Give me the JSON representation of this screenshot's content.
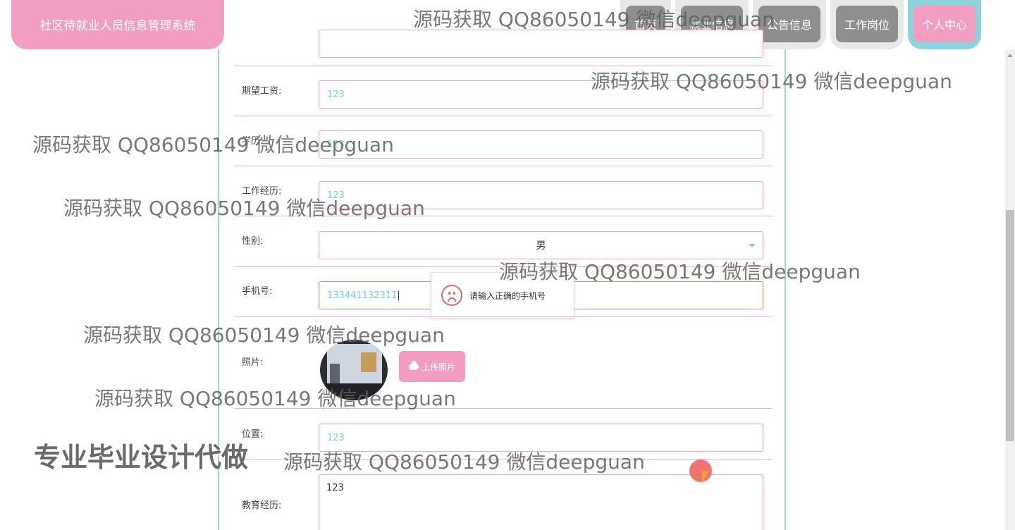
{
  "header": {
    "brand_title": "社区待就业人员信息管理系统",
    "nav": [
      {
        "label": "首页"
      },
      {
        "label": "就业信息"
      },
      {
        "label": "公告信息"
      },
      {
        "label": "工作岗位"
      },
      {
        "label": "个人中心"
      }
    ],
    "active_nav": "个人中心"
  },
  "form": {
    "expected_salary": {
      "label": "期望工资:",
      "value": "123"
    },
    "education": {
      "label": "学历:",
      "value": "123"
    },
    "work_experience": {
      "label": "工作经历:",
      "value": "123"
    },
    "gender": {
      "label": "性别:",
      "value": "男"
    },
    "phone": {
      "label": "手机号:",
      "value": "133441132311",
      "error": "请输入正确的手机号"
    },
    "photo": {
      "label": "照片:",
      "upload_label": "上传照片"
    },
    "location": {
      "label": "位置:",
      "value": "123"
    },
    "education_history": {
      "label": "教育经历:",
      "value": "123"
    }
  },
  "watermark": "源码获取 QQ86050149 微信deepguan",
  "promo_text": "专业毕业设计代做",
  "colors": {
    "brand": "#f19ec2",
    "accent": "#8ed3dc",
    "nav_inactive": "#8f8f8f",
    "field_value": "#7ccbe0"
  }
}
